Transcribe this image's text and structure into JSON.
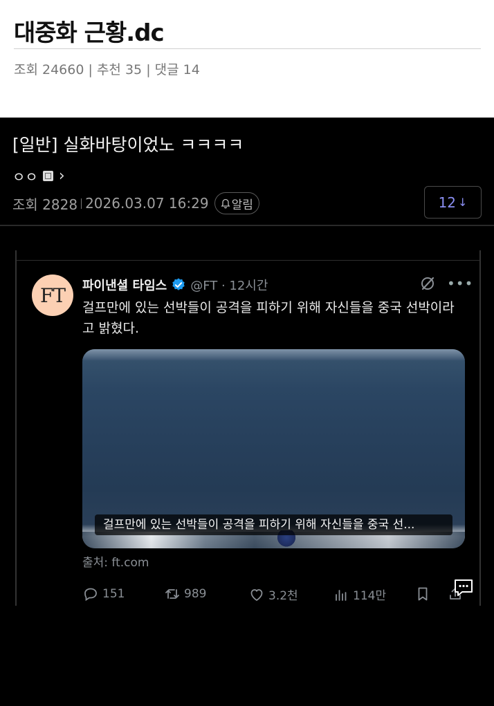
{
  "header": {
    "title": "대중화 근황.dc",
    "views_label": "조회 24660",
    "recommend_label": "추천 35",
    "comments_label": "댓글 14"
  },
  "post": {
    "title": "[일반] 실화바탕이었노 ㅋㅋㅋㅋ",
    "author": "ㅇㅇ",
    "views_label": "조회 2828",
    "datetime": "2026.03.07 16:29",
    "alarm_label": "알림",
    "comment_count": "12",
    "comment_arrow": "↓"
  },
  "tweet": {
    "avatar_text": "FT",
    "name": "파이낸셜 타임스",
    "handle_time": "@FT · 12시간",
    "text": "걸프만에 있는 선박들이 공격을 피하기 위해 자신들을 중국 선박이라고 밝혔다.",
    "media_caption": "걸프만에 있는 선박들이 공격을 피하기 위해 자신들을 중국 선...",
    "source": "출처: ft.com",
    "replies": "151",
    "retweets": "989",
    "likes": "3.2천",
    "views": "114만",
    "more": "•••"
  },
  "colors": {
    "accent": "#8b8ff2",
    "verified": "#1d9bf0",
    "avatar_bg": "#fcd0b3"
  }
}
